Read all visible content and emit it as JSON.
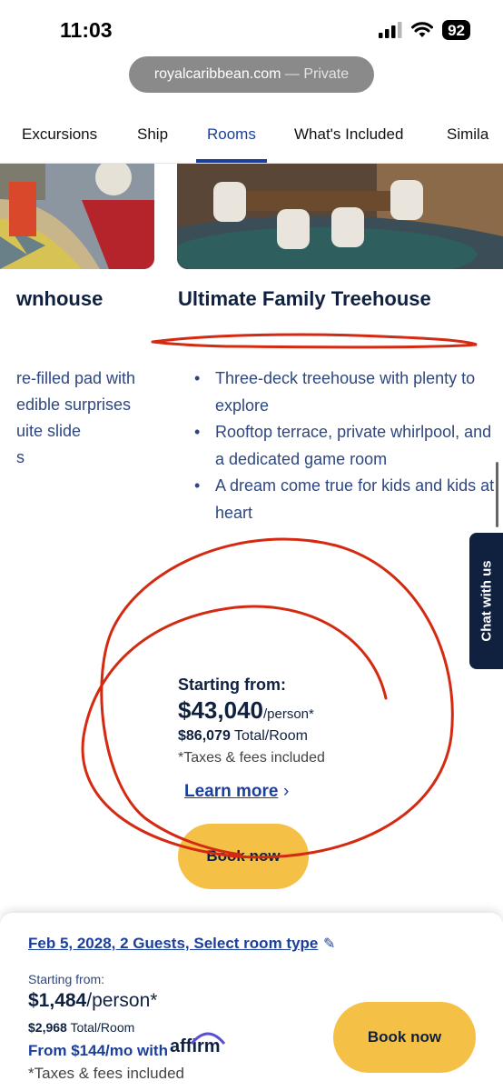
{
  "status_bar": {
    "time": "11:03",
    "battery": "92"
  },
  "browser": {
    "domain": "royalcaribbean.com",
    "private_label": "— Private"
  },
  "tabs": [
    {
      "label": "Excursions"
    },
    {
      "label": "Ship"
    },
    {
      "label": "Rooms",
      "active": true
    },
    {
      "label": "What's Included"
    },
    {
      "label": "Simila"
    }
  ],
  "rooms": {
    "left_title": "wnhouse",
    "left_bullets": [
      "re-filled pad with",
      "edible surprises",
      "uite slide",
      "s"
    ],
    "right_title": "Ultimate Family Treehouse",
    "right_bullets": [
      "Three-deck treehouse with plenty to explore",
      "Rooftop terrace, private whirlpool, and a dedicated game room",
      "A dream come true for kids and kids at heart"
    ]
  },
  "chat": {
    "label": "Chat with us"
  },
  "room_price": {
    "label": "Starting from:",
    "price": "$43,040",
    "per": "/person*",
    "total_value": "$86,079",
    "total_label": "Total/Room",
    "taxes": "*Taxes & fees included",
    "learn_more": "Learn more",
    "book_label": "Book now"
  },
  "bottom_bar": {
    "selection": "Feb 5, 2028, 2 Guests, Select room type",
    "label": "Starting from:",
    "price": "$1,484",
    "per": "/person*",
    "total_value": "$2,968",
    "total_label": "Total/Room",
    "monthly": "From $144/mo with",
    "affirm": "affirm",
    "taxes": "*Taxes & fees included",
    "book_label": "Book now"
  },
  "colors": {
    "brand_navy": "#10213f",
    "link_blue": "#1c3f9c",
    "cta_yellow": "#f5c046",
    "annotation_red": "#d42a12"
  }
}
